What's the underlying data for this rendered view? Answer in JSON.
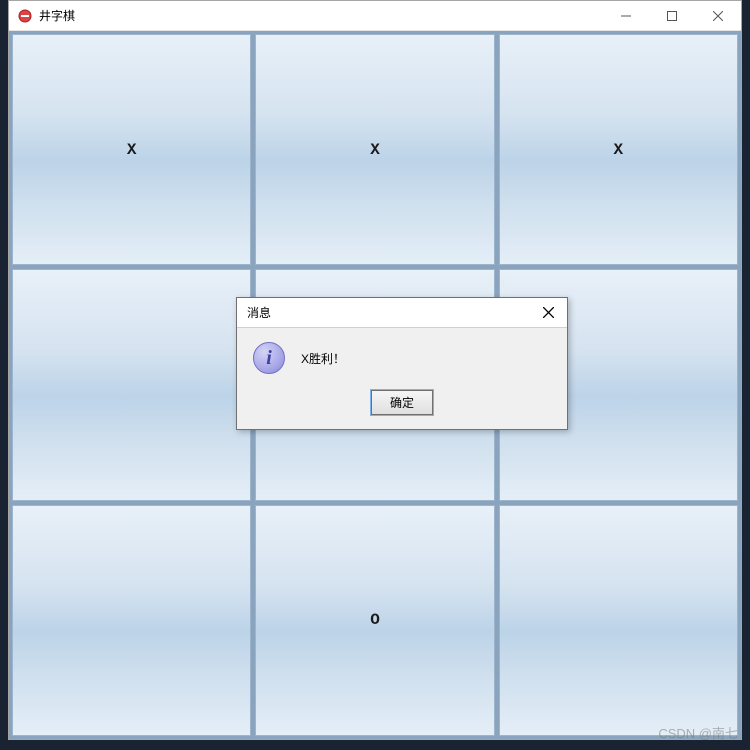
{
  "window": {
    "title": "井字棋"
  },
  "board": {
    "cells": [
      "X",
      "X",
      "X",
      "",
      "",
      "",
      "",
      "O",
      ""
    ]
  },
  "dialog": {
    "title": "消息",
    "message": "X胜利！",
    "ok_label": "确定"
  },
  "watermark": "CSDN @南七"
}
